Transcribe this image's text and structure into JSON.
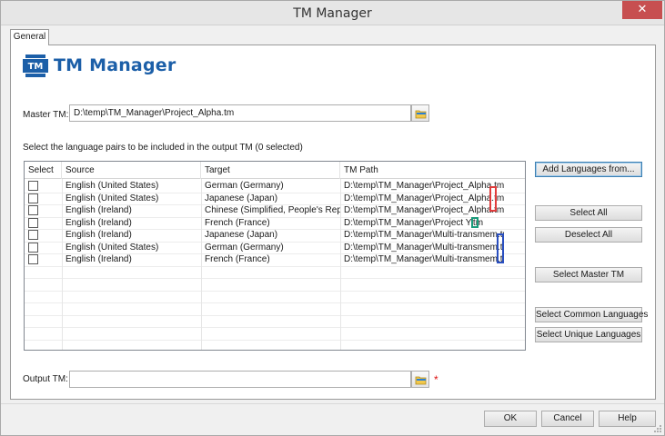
{
  "window": {
    "title": "TM Manager",
    "close_glyph": "✕"
  },
  "tabs": [
    {
      "label": "General"
    }
  ],
  "header": {
    "logo_badge": "TM",
    "title": "TM Manager"
  },
  "master_tm": {
    "label": "Master TM:",
    "value": "D:\\temp\\TM_Manager\\Project_Alpha.tm",
    "browse_icon": "folder-browse-icon"
  },
  "instruction": "Select the language pairs to be included in the output TM (0 selected)",
  "table": {
    "columns": [
      "Select",
      "Source",
      "Target",
      "TM Path"
    ],
    "rows": [
      {
        "checked": false,
        "source": "English (United States)",
        "target": "German (Germany)",
        "path": "D:\\temp\\TM_Manager\\Project_Alpha.tm"
      },
      {
        "checked": false,
        "source": "English (United States)",
        "target": "Japanese (Japan)",
        "path": "D:\\temp\\TM_Manager\\Project_Alpha.tm"
      },
      {
        "checked": false,
        "source": "English (Ireland)",
        "target": "Chinese (Simplified, People's Repu...",
        "path": "D:\\temp\\TM_Manager\\Project_Alpha.tm"
      },
      {
        "checked": false,
        "source": "English (Ireland)",
        "target": "French (France)",
        "path": "D:\\temp\\TM_Manager\\Project Y.tm"
      },
      {
        "checked": false,
        "source": "English (Ireland)",
        "target": "Japanese (Japan)",
        "path": "D:\\temp\\TM_Manager\\Multi-transmem.tm"
      },
      {
        "checked": false,
        "source": "English (United States)",
        "target": "German (Germany)",
        "path": "D:\\temp\\TM_Manager\\Multi-transmem.tm"
      },
      {
        "checked": false,
        "source": "English (Ireland)",
        "target": "French (France)",
        "path": "D:\\temp\\TM_Manager\\Multi-transmem.tm"
      }
    ]
  },
  "side_buttons": {
    "add_languages": "Add Languages from...",
    "select_all": "Select All",
    "deselect_all": "Deselect All",
    "select_master": "Select Master TM",
    "select_common": "Select Common Languages",
    "select_unique": "Select Unique Languages"
  },
  "output_tm": {
    "label": "Output TM:",
    "value": "",
    "required_mark": "*"
  },
  "footer": {
    "ok": "OK",
    "cancel": "Cancel",
    "help": "Help"
  },
  "colors": {
    "accent": "#1c5fa8",
    "close": "#c74f50",
    "annotation_red": "#e03c3c",
    "annotation_teal": "#1a9a7a",
    "annotation_blue": "#2a4fc0"
  }
}
